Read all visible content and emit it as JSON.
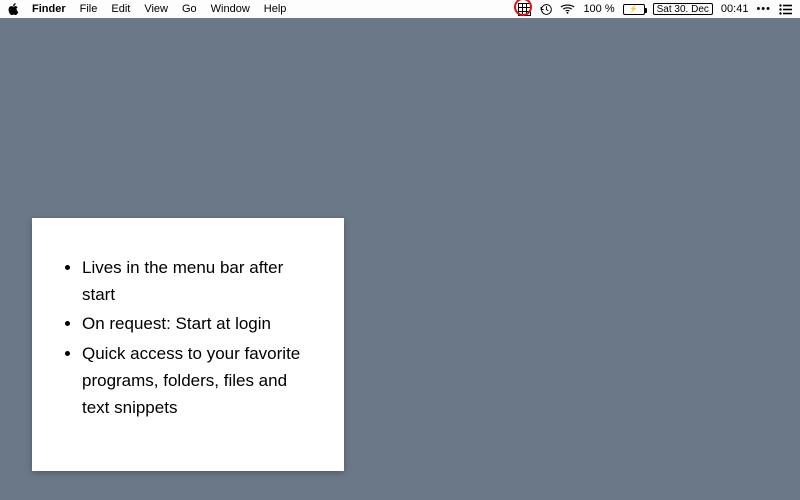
{
  "menubar": {
    "app_name": "Finder",
    "items": [
      "File",
      "Edit",
      "View",
      "Go",
      "Window",
      "Help"
    ]
  },
  "status": {
    "battery_percent": "100 %",
    "date_text": "Sat 30. Dec",
    "time_text": "00:41"
  },
  "card": {
    "bullets": [
      "Lives in the menu bar after start",
      "On request: Start at login",
      "Quick access to your favorite programs, folders, files and text snippets"
    ]
  },
  "highlight": {
    "target": "menu-bar-grid-icon"
  }
}
